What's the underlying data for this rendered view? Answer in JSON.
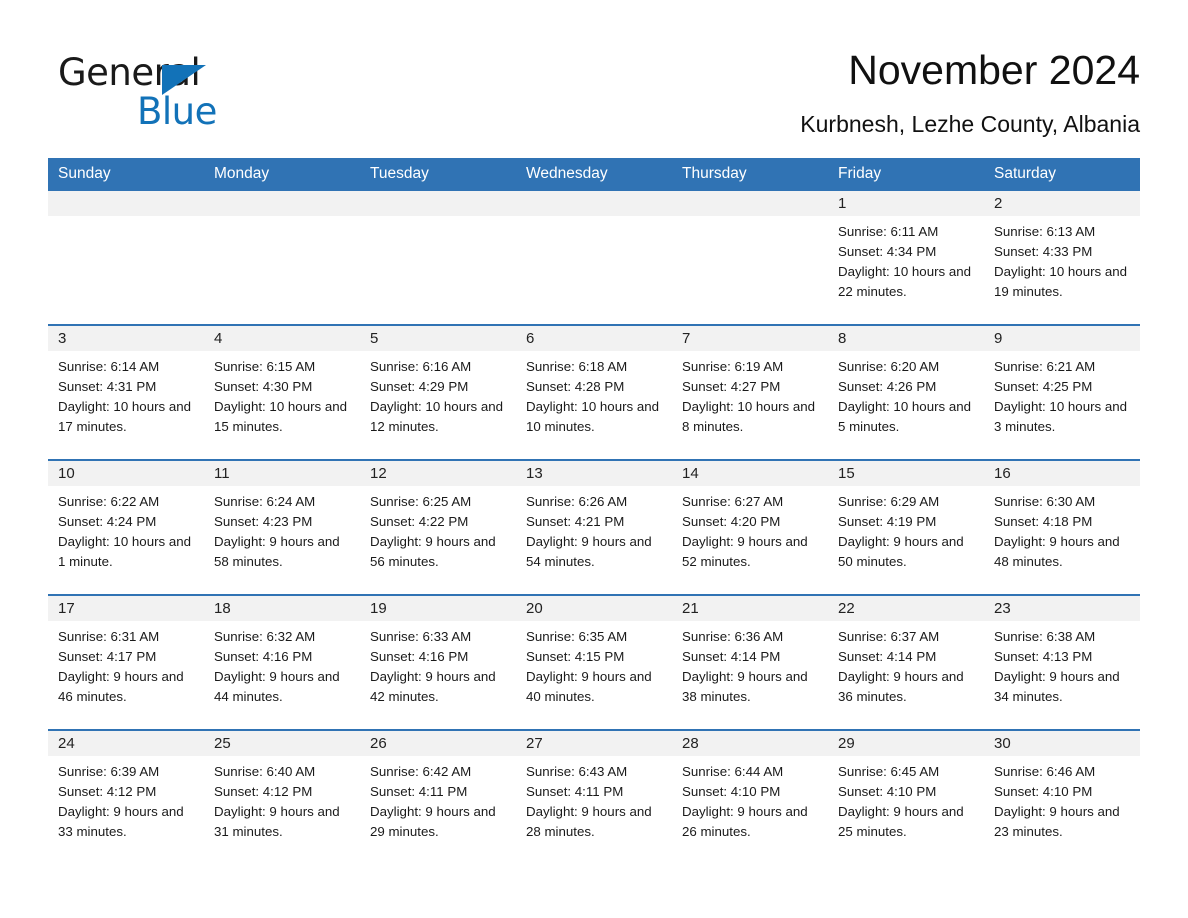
{
  "logo": {
    "word_one": "General",
    "word_two": "Blue",
    "triangle_color": "#1272b8",
    "text_color": "#1a1a1a"
  },
  "header": {
    "month_title": "November 2024",
    "location": "Kurbnesh, Lezhe County, Albania"
  },
  "theme": {
    "header_blue": "#3073b4",
    "day_band_gray": "#f2f2f2",
    "row_divider": "#3073b4"
  },
  "weekdays": [
    "Sunday",
    "Monday",
    "Tuesday",
    "Wednesday",
    "Thursday",
    "Friday",
    "Saturday"
  ],
  "labels": {
    "sunrise_prefix": "Sunrise:",
    "sunset_prefix": "Sunset:",
    "daylight_prefix": "Daylight:"
  },
  "weeks": [
    [
      {
        "empty": true
      },
      {
        "empty": true
      },
      {
        "empty": true
      },
      {
        "empty": true
      },
      {
        "empty": true
      },
      {
        "empty": false,
        "day": "1",
        "sunrise": "Sunrise: 6:11 AM",
        "sunset": "Sunset: 4:34 PM",
        "daylight": "Daylight: 10 hours and 22 minutes."
      },
      {
        "empty": false,
        "day": "2",
        "sunrise": "Sunrise: 6:13 AM",
        "sunset": "Sunset: 4:33 PM",
        "daylight": "Daylight: 10 hours and 19 minutes."
      }
    ],
    [
      {
        "empty": false,
        "day": "3",
        "sunrise": "Sunrise: 6:14 AM",
        "sunset": "Sunset: 4:31 PM",
        "daylight": "Daylight: 10 hours and 17 minutes."
      },
      {
        "empty": false,
        "day": "4",
        "sunrise": "Sunrise: 6:15 AM",
        "sunset": "Sunset: 4:30 PM",
        "daylight": "Daylight: 10 hours and 15 minutes."
      },
      {
        "empty": false,
        "day": "5",
        "sunrise": "Sunrise: 6:16 AM",
        "sunset": "Sunset: 4:29 PM",
        "daylight": "Daylight: 10 hours and 12 minutes."
      },
      {
        "empty": false,
        "day": "6",
        "sunrise": "Sunrise: 6:18 AM",
        "sunset": "Sunset: 4:28 PM",
        "daylight": "Daylight: 10 hours and 10 minutes."
      },
      {
        "empty": false,
        "day": "7",
        "sunrise": "Sunrise: 6:19 AM",
        "sunset": "Sunset: 4:27 PM",
        "daylight": "Daylight: 10 hours and 8 minutes."
      },
      {
        "empty": false,
        "day": "8",
        "sunrise": "Sunrise: 6:20 AM",
        "sunset": "Sunset: 4:26 PM",
        "daylight": "Daylight: 10 hours and 5 minutes."
      },
      {
        "empty": false,
        "day": "9",
        "sunrise": "Sunrise: 6:21 AM",
        "sunset": "Sunset: 4:25 PM",
        "daylight": "Daylight: 10 hours and 3 minutes."
      }
    ],
    [
      {
        "empty": false,
        "day": "10",
        "sunrise": "Sunrise: 6:22 AM",
        "sunset": "Sunset: 4:24 PM",
        "daylight": "Daylight: 10 hours and 1 minute."
      },
      {
        "empty": false,
        "day": "11",
        "sunrise": "Sunrise: 6:24 AM",
        "sunset": "Sunset: 4:23 PM",
        "daylight": "Daylight: 9 hours and 58 minutes."
      },
      {
        "empty": false,
        "day": "12",
        "sunrise": "Sunrise: 6:25 AM",
        "sunset": "Sunset: 4:22 PM",
        "daylight": "Daylight: 9 hours and 56 minutes."
      },
      {
        "empty": false,
        "day": "13",
        "sunrise": "Sunrise: 6:26 AM",
        "sunset": "Sunset: 4:21 PM",
        "daylight": "Daylight: 9 hours and 54 minutes."
      },
      {
        "empty": false,
        "day": "14",
        "sunrise": "Sunrise: 6:27 AM",
        "sunset": "Sunset: 4:20 PM",
        "daylight": "Daylight: 9 hours and 52 minutes."
      },
      {
        "empty": false,
        "day": "15",
        "sunrise": "Sunrise: 6:29 AM",
        "sunset": "Sunset: 4:19 PM",
        "daylight": "Daylight: 9 hours and 50 minutes."
      },
      {
        "empty": false,
        "day": "16",
        "sunrise": "Sunrise: 6:30 AM",
        "sunset": "Sunset: 4:18 PM",
        "daylight": "Daylight: 9 hours and 48 minutes."
      }
    ],
    [
      {
        "empty": false,
        "day": "17",
        "sunrise": "Sunrise: 6:31 AM",
        "sunset": "Sunset: 4:17 PM",
        "daylight": "Daylight: 9 hours and 46 minutes."
      },
      {
        "empty": false,
        "day": "18",
        "sunrise": "Sunrise: 6:32 AM",
        "sunset": "Sunset: 4:16 PM",
        "daylight": "Daylight: 9 hours and 44 minutes."
      },
      {
        "empty": false,
        "day": "19",
        "sunrise": "Sunrise: 6:33 AM",
        "sunset": "Sunset: 4:16 PM",
        "daylight": "Daylight: 9 hours and 42 minutes."
      },
      {
        "empty": false,
        "day": "20",
        "sunrise": "Sunrise: 6:35 AM",
        "sunset": "Sunset: 4:15 PM",
        "daylight": "Daylight: 9 hours and 40 minutes."
      },
      {
        "empty": false,
        "day": "21",
        "sunrise": "Sunrise: 6:36 AM",
        "sunset": "Sunset: 4:14 PM",
        "daylight": "Daylight: 9 hours and 38 minutes."
      },
      {
        "empty": false,
        "day": "22",
        "sunrise": "Sunrise: 6:37 AM",
        "sunset": "Sunset: 4:14 PM",
        "daylight": "Daylight: 9 hours and 36 minutes."
      },
      {
        "empty": false,
        "day": "23",
        "sunrise": "Sunrise: 6:38 AM",
        "sunset": "Sunset: 4:13 PM",
        "daylight": "Daylight: 9 hours and 34 minutes."
      }
    ],
    [
      {
        "empty": false,
        "day": "24",
        "sunrise": "Sunrise: 6:39 AM",
        "sunset": "Sunset: 4:12 PM",
        "daylight": "Daylight: 9 hours and 33 minutes."
      },
      {
        "empty": false,
        "day": "25",
        "sunrise": "Sunrise: 6:40 AM",
        "sunset": "Sunset: 4:12 PM",
        "daylight": "Daylight: 9 hours and 31 minutes."
      },
      {
        "empty": false,
        "day": "26",
        "sunrise": "Sunrise: 6:42 AM",
        "sunset": "Sunset: 4:11 PM",
        "daylight": "Daylight: 9 hours and 29 minutes."
      },
      {
        "empty": false,
        "day": "27",
        "sunrise": "Sunrise: 6:43 AM",
        "sunset": "Sunset: 4:11 PM",
        "daylight": "Daylight: 9 hours and 28 minutes."
      },
      {
        "empty": false,
        "day": "28",
        "sunrise": "Sunrise: 6:44 AM",
        "sunset": "Sunset: 4:10 PM",
        "daylight": "Daylight: 9 hours and 26 minutes."
      },
      {
        "empty": false,
        "day": "29",
        "sunrise": "Sunrise: 6:45 AM",
        "sunset": "Sunset: 4:10 PM",
        "daylight": "Daylight: 9 hours and 25 minutes."
      },
      {
        "empty": false,
        "day": "30",
        "sunrise": "Sunrise: 6:46 AM",
        "sunset": "Sunset: 4:10 PM",
        "daylight": "Daylight: 9 hours and 23 minutes."
      }
    ]
  ]
}
